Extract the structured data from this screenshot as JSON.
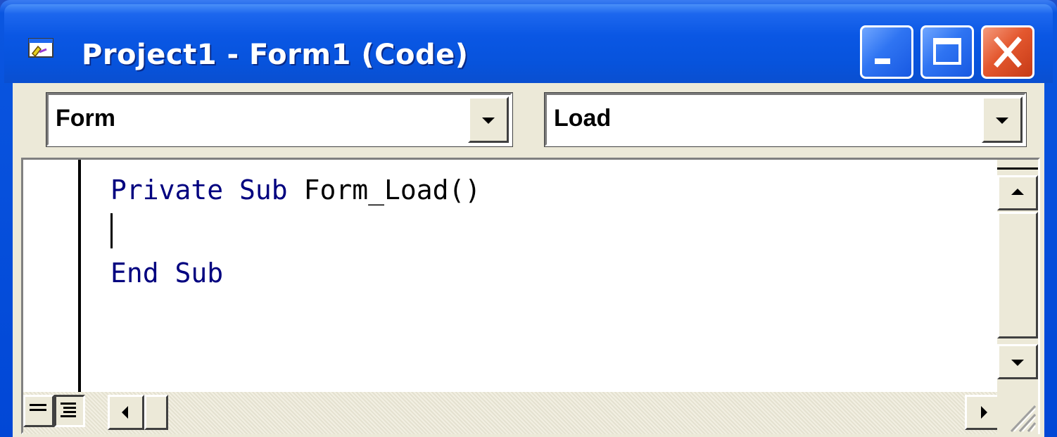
{
  "window": {
    "title": "Project1 - Form1 (Code)",
    "icon": "code-window-icon",
    "controls": [
      "minimize-icon",
      "maximize-icon",
      "close-icon"
    ]
  },
  "object_combo": {
    "selected": "Form"
  },
  "procedure_combo": {
    "selected": "Load"
  },
  "code": {
    "line1": {
      "keyword1": "Private",
      "keyword2": "Sub",
      "name": "Form_Load()"
    },
    "line3": {
      "keyword1": "End",
      "keyword2": "Sub"
    }
  },
  "colors": {
    "title_bar": "#0753dc",
    "close_button": "#e4582f",
    "client_background": "#ece9d8",
    "keyword": "#00007f"
  }
}
